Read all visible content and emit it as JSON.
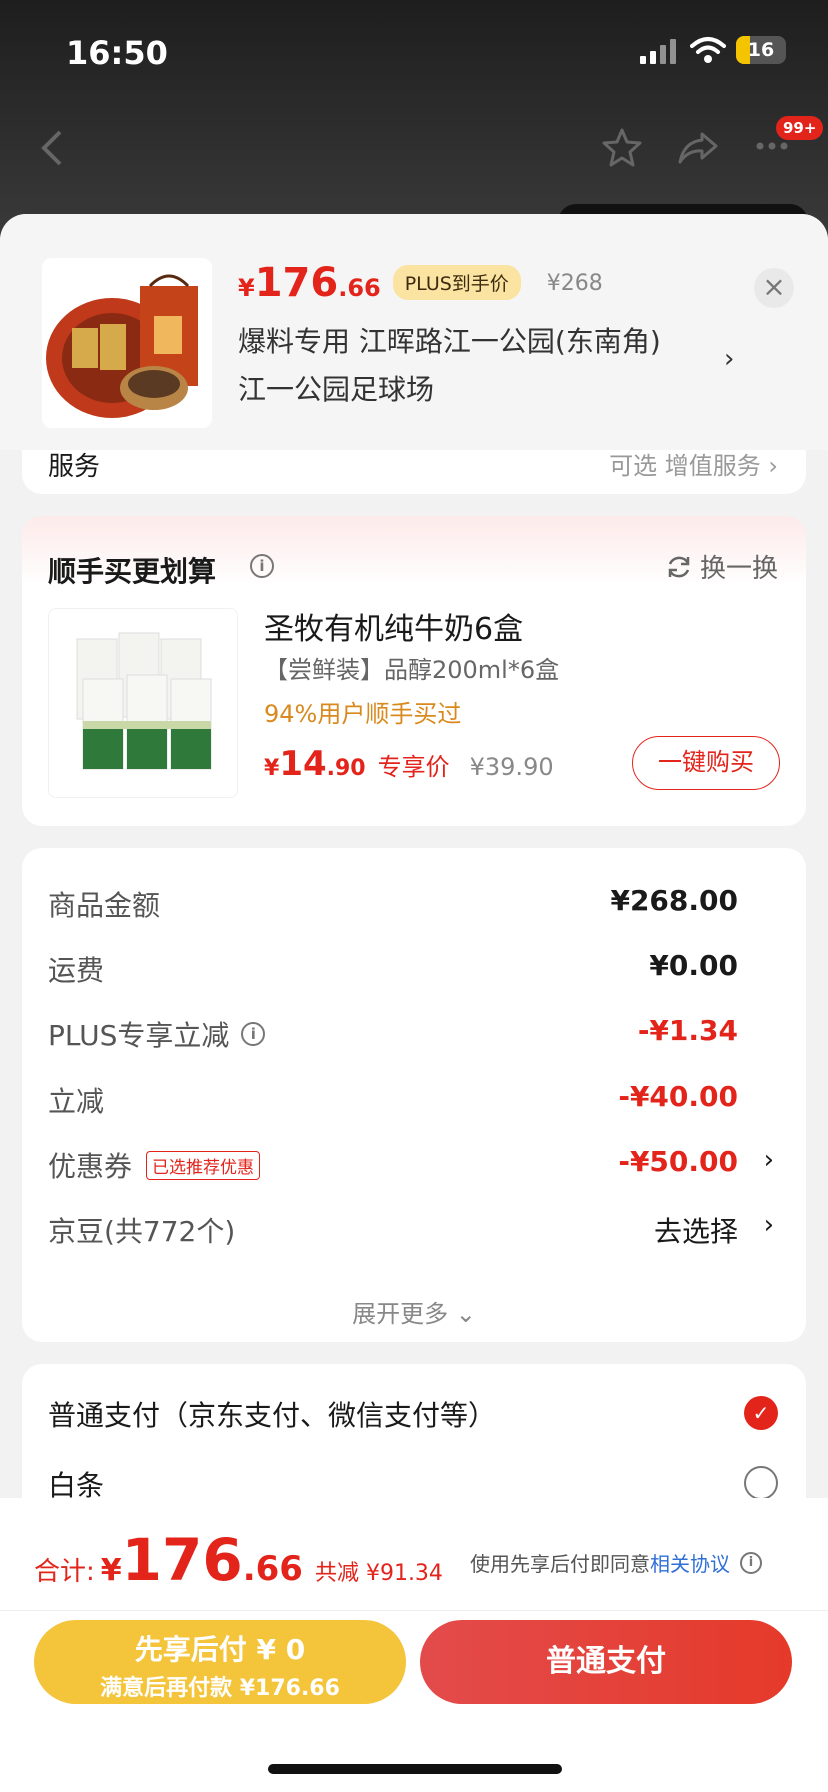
{
  "status": {
    "time": "16:50",
    "battery": "16"
  },
  "nav": {
    "badge": "99+"
  },
  "product": {
    "price_yen": "¥",
    "price_int": "176",
    "price_dec": ".66",
    "plus_tag": "PLUS到手价",
    "original_price": "¥268",
    "address_line1": "爆料专用  江晖路江一公园(东南角)",
    "address_line2": "江一公园足球场"
  },
  "peek": {
    "left": "服务",
    "right": "可选 增值服务 ›"
  },
  "add_on": {
    "title": "顺手买更划算",
    "swap_label": "换一换",
    "item_name": "圣牧有机纯牛奶6盒",
    "item_sub": "【尝鲜装】品醇200ml*6盒",
    "item_pct": "94%用户顺手买过",
    "price_yen": "¥",
    "price_int": "14",
    "price_dec": ".90",
    "price_tag": "专享价",
    "price_orig": "¥39.90",
    "buy_label": "一键购买"
  },
  "summary": {
    "goods_label": "商品金额",
    "goods_value": "¥268.00",
    "shipping_label": "运费",
    "shipping_value": "¥0.00",
    "plus_label": "PLUS专享立减",
    "plus_value": "-¥1.34",
    "discount_label": "立减",
    "discount_value": "-¥40.00",
    "coupon_label": "优惠券",
    "coupon_tag": "已选推荐优惠",
    "coupon_value": "-¥50.00",
    "beans_label": "京豆(共772个)",
    "beans_value": "去选择",
    "expand_label": "展开更多 ⌄"
  },
  "payment": {
    "normal_label": "普通支付（京东支付、微信支付等）",
    "baitiao_label": "白条"
  },
  "bottom": {
    "total_label": "合计:",
    "total_yen": "¥",
    "total_int": "176",
    "total_dec": ".66",
    "saved": "共减 ¥91.34",
    "agree_text": "使用先享后付即同意",
    "agree_link": "相关协议",
    "later_line1": "先享后付 ¥ 0",
    "later_line2": "满意后再付款 ¥176.66",
    "pay_label": "普通支付"
  },
  "colors": {
    "accent": "#e3241b",
    "gold": "#f4c43b",
    "link": "#2f6fd6"
  }
}
